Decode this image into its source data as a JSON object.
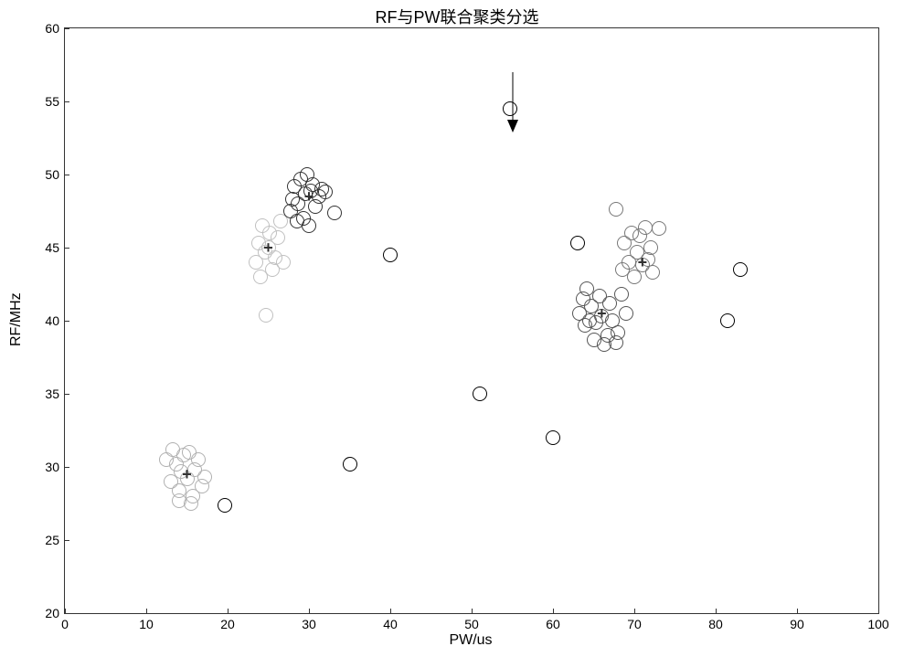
{
  "chart_data": {
    "type": "scatter",
    "title": "RF与PW联合聚类分选",
    "xlabel": "PW/us",
    "ylabel": "RF/MHz",
    "xlim": [
      0,
      100
    ],
    "ylim": [
      20,
      60
    ],
    "xticks": [
      0,
      10,
      20,
      30,
      40,
      50,
      60,
      70,
      80,
      90,
      100
    ],
    "yticks": [
      20,
      25,
      30,
      35,
      40,
      45,
      50,
      55,
      60
    ],
    "marker_radius_px": 7,
    "annotations": [
      {
        "type": "arrow",
        "x": 55,
        "y_from": 57,
        "y_to": 53
      }
    ],
    "centroids": [
      {
        "x": 15,
        "y": 29.5
      },
      {
        "x": 25,
        "y": 45
      },
      {
        "x": 30,
        "y": 48.5
      },
      {
        "x": 66,
        "y": 40.5
      },
      {
        "x": 71,
        "y": 44
      }
    ],
    "series": [
      {
        "name": "cluster1",
        "color": "#b0b0b0",
        "points": [
          {
            "x": 12.5,
            "y": 30.5
          },
          {
            "x": 13,
            "y": 29.0
          },
          {
            "x": 13.3,
            "y": 31.2
          },
          {
            "x": 13.7,
            "y": 30.2
          },
          {
            "x": 14.0,
            "y": 28.4
          },
          {
            "x": 14.3,
            "y": 29.7
          },
          {
            "x": 14.6,
            "y": 30.8
          },
          {
            "x": 15.0,
            "y": 29.2
          },
          {
            "x": 15.3,
            "y": 31.0
          },
          {
            "x": 15.7,
            "y": 28.0
          },
          {
            "x": 16.0,
            "y": 29.8
          },
          {
            "x": 16.4,
            "y": 30.5
          },
          {
            "x": 16.8,
            "y": 28.7
          },
          {
            "x": 17.2,
            "y": 29.3
          },
          {
            "x": 15.5,
            "y": 27.5
          },
          {
            "x": 14.0,
            "y": 27.7
          }
        ]
      },
      {
        "name": "cluster2",
        "color": "#c0c0c0",
        "points": [
          {
            "x": 23.5,
            "y": 44.0
          },
          {
            "x": 23.8,
            "y": 45.3
          },
          {
            "x": 24.0,
            "y": 43.0
          },
          {
            "x": 24.3,
            "y": 46.5
          },
          {
            "x": 24.6,
            "y": 44.7
          },
          {
            "x": 25.0,
            "y": 45.0
          },
          {
            "x": 25.2,
            "y": 46.0
          },
          {
            "x": 25.5,
            "y": 43.5
          },
          {
            "x": 25.8,
            "y": 44.3
          },
          {
            "x": 26.2,
            "y": 45.7
          },
          {
            "x": 26.5,
            "y": 46.8
          },
          {
            "x": 26.9,
            "y": 44.0
          },
          {
            "x": 24.7,
            "y": 40.4
          }
        ]
      },
      {
        "name": "cluster3",
        "color": "#333333",
        "points": [
          {
            "x": 27.7,
            "y": 47.5
          },
          {
            "x": 28.0,
            "y": 48.3
          },
          {
            "x": 28.2,
            "y": 49.2
          },
          {
            "x": 28.5,
            "y": 46.8
          },
          {
            "x": 28.7,
            "y": 48.0
          },
          {
            "x": 29.0,
            "y": 49.7
          },
          {
            "x": 29.3,
            "y": 47.0
          },
          {
            "x": 29.5,
            "y": 48.7
          },
          {
            "x": 29.8,
            "y": 50.0
          },
          {
            "x": 30.0,
            "y": 46.5
          },
          {
            "x": 30.2,
            "y": 48.9
          },
          {
            "x": 30.5,
            "y": 49.3
          },
          {
            "x": 30.8,
            "y": 47.8
          },
          {
            "x": 31.2,
            "y": 48.5
          },
          {
            "x": 31.6,
            "y": 49.0
          },
          {
            "x": 32.0,
            "y": 48.8
          },
          {
            "x": 33.2,
            "y": 47.4
          }
        ]
      },
      {
        "name": "cluster4",
        "color": "#555555",
        "points": [
          {
            "x": 63.3,
            "y": 40.5
          },
          {
            "x": 63.7,
            "y": 41.5
          },
          {
            "x": 63.9,
            "y": 39.7
          },
          {
            "x": 64.2,
            "y": 42.2
          },
          {
            "x": 64.5,
            "y": 40.0
          },
          {
            "x": 64.7,
            "y": 41.0
          },
          {
            "x": 65.0,
            "y": 38.7
          },
          {
            "x": 65.3,
            "y": 39.9
          },
          {
            "x": 65.7,
            "y": 41.7
          },
          {
            "x": 66.0,
            "y": 40.3
          },
          {
            "x": 66.3,
            "y": 38.4
          },
          {
            "x": 66.7,
            "y": 39.0
          },
          {
            "x": 67.0,
            "y": 41.2
          },
          {
            "x": 67.3,
            "y": 40.0
          },
          {
            "x": 67.8,
            "y": 38.5
          },
          {
            "x": 68.4,
            "y": 41.8
          },
          {
            "x": 69.0,
            "y": 40.5
          },
          {
            "x": 68.0,
            "y": 39.2
          }
        ]
      },
      {
        "name": "cluster5",
        "color": "#777777",
        "points": [
          {
            "x": 68.5,
            "y": 43.5
          },
          {
            "x": 68.8,
            "y": 45.3
          },
          {
            "x": 69.3,
            "y": 44.0
          },
          {
            "x": 69.7,
            "y": 46.0
          },
          {
            "x": 70.0,
            "y": 43.0
          },
          {
            "x": 70.3,
            "y": 44.7
          },
          {
            "x": 70.7,
            "y": 45.8
          },
          {
            "x": 71.0,
            "y": 43.8
          },
          {
            "x": 71.3,
            "y": 46.4
          },
          {
            "x": 71.7,
            "y": 44.2
          },
          {
            "x": 72.0,
            "y": 45.0
          },
          {
            "x": 72.3,
            "y": 43.3
          },
          {
            "x": 67.8,
            "y": 47.6
          },
          {
            "x": 73.0,
            "y": 46.3
          }
        ]
      },
      {
        "name": "outliers",
        "color": "#000000",
        "points": [
          {
            "x": 19.7,
            "y": 27.4
          },
          {
            "x": 35.0,
            "y": 30.2
          },
          {
            "x": 40.0,
            "y": 44.5
          },
          {
            "x": 51.0,
            "y": 35.0
          },
          {
            "x": 54.7,
            "y": 54.5
          },
          {
            "x": 60.0,
            "y": 32.0
          },
          {
            "x": 63.0,
            "y": 45.3
          },
          {
            "x": 81.5,
            "y": 40.0
          },
          {
            "x": 83.0,
            "y": 43.5
          }
        ]
      }
    ]
  }
}
